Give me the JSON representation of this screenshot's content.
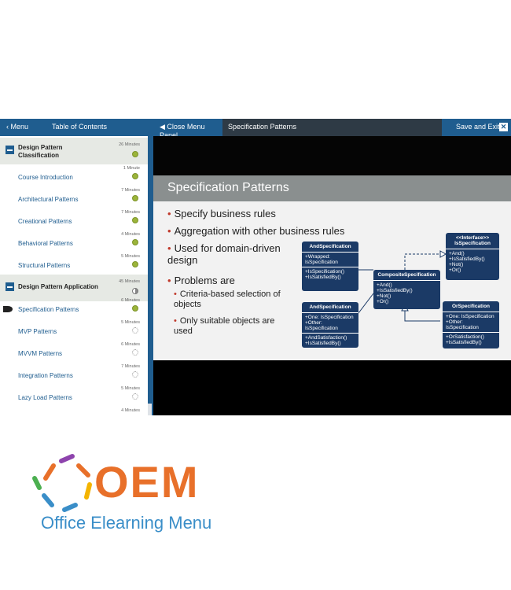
{
  "topbar": {
    "menu_label": "Menu",
    "toc_label": "Table of Contents",
    "close_panel_label": "Close Menu Panel",
    "page_title": "Specification Patterns",
    "save_exit_label": "Save and Exit"
  },
  "sidebar": {
    "sections": [
      {
        "title": "Design Pattern Classification",
        "minutes": "26 Minutes",
        "status": "done"
      },
      {
        "title": "Design Pattern Application",
        "minutes": "45 Minutes",
        "status": "half"
      }
    ],
    "items": [
      {
        "title": "Course Introduction",
        "minutes": "1 Minute",
        "status": "done"
      },
      {
        "title": "Architectural Patterns",
        "minutes": "7 Minutes",
        "status": "done"
      },
      {
        "title": "Creational Patterns",
        "minutes": "7 Minutes",
        "status": "done"
      },
      {
        "title": "Behavioral Patterns",
        "minutes": "4 Minutes",
        "status": "done"
      },
      {
        "title": "Structural Patterns",
        "minutes": "5 Minutes",
        "status": "done"
      },
      {
        "title": "Specification Patterns",
        "minutes": "6 Minutes",
        "status": "done"
      },
      {
        "title": "MVP Patterns",
        "minutes": "5 Minutes",
        "status": "empty"
      },
      {
        "title": "MVVM Patterns",
        "minutes": "6 Minutes",
        "status": "empty"
      },
      {
        "title": "Integration Patterns",
        "minutes": "7 Minutes",
        "status": "empty"
      },
      {
        "title": "Lazy Load Patterns",
        "minutes": "5 Minutes",
        "status": "empty"
      },
      {
        "title": "",
        "minutes": "4 Minutes",
        "status": "empty"
      }
    ]
  },
  "slide": {
    "title": "Specification Patterns",
    "bullets": [
      "Specify business rules",
      "Aggregation with other business rules",
      "Used for domain-driven design",
      "Problems are"
    ],
    "sub_bullets": [
      "Criteria-based selection of objects",
      "Only suitable objects are used"
    ],
    "diagram": {
      "and_spec": {
        "title": "AndSpecification",
        "fields": [
          "+Wrapped: IsSpecification"
        ],
        "methods": [
          "+IsSpecification()",
          "+IsSatisfiedBy()"
        ]
      },
      "and_spec2": {
        "title": "AndSpecification",
        "fields": [
          "+One: IsSpecification",
          "+Other: IsSpecification"
        ],
        "methods": [
          "+AndSatisfaction()",
          "+IsSatisfiedBy()"
        ]
      },
      "composite": {
        "title": "CompositeSpecification",
        "methods": [
          "+And()",
          "+IsSatisfiedBy()",
          "+Not()",
          "+Or()"
        ]
      },
      "interface": {
        "stereotype": "<<Interface>>",
        "title": "IsSpecification",
        "methods": [
          "+And()",
          "+IsSatisfiedBy()",
          "+Not()",
          "+Or()"
        ]
      },
      "or_spec": {
        "title": "OrSpecification",
        "fields": [
          "+One: IsSpecification",
          "+Other: IsSpecification"
        ],
        "methods": [
          "+OrSatisfaction()",
          "+IsSatisfiedBy()"
        ]
      }
    }
  },
  "brand": {
    "name": "OEM",
    "tagline": "Office Elearning Menu",
    "colors": {
      "orange": "#e8702a",
      "blue": "#3a8ec8"
    }
  }
}
